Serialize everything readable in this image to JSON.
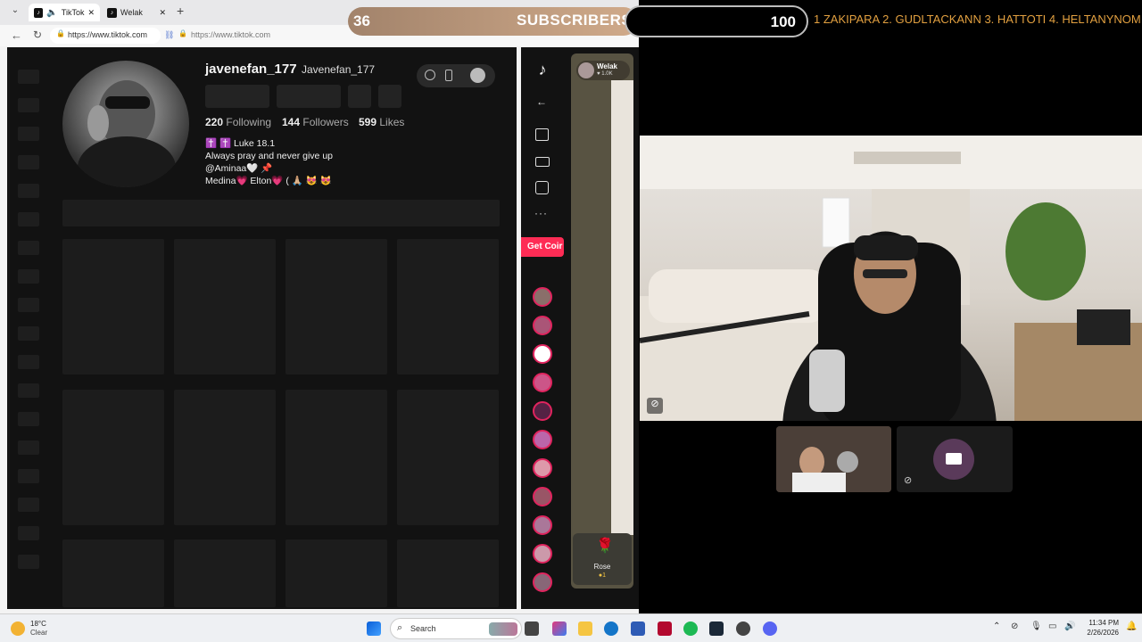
{
  "browser": {
    "tabs": [
      {
        "label": "TikTok"
      },
      {
        "label": "Welak"
      }
    ],
    "address": {
      "url": "https://www.tiktok.com",
      "url2": "https://www.tiktok.com"
    }
  },
  "profile": {
    "username": "javenefan_177",
    "display_name": "Javenefan_177",
    "following_count": "220",
    "following_label": "Following",
    "followers_count": "144",
    "followers_label": "Followers",
    "likes_count": "599",
    "likes_label": "Likes",
    "bio": [
      "✝️ ✝️ Luke 18.1",
      "Always pray and never give up",
      "@Aminaa🤍 📌",
      "Medina💗 Elton💗 ( 🙏🏼 😻 😻"
    ]
  },
  "live": {
    "get_coins": "Get Coir",
    "host": "Welak",
    "host_likes": "♥ 1.0K",
    "gift_name": "Rose",
    "gift_cost": "1"
  },
  "overlay": {
    "subs_count": "36",
    "subs_label": "SUBSCRIBERS",
    "goal": "100",
    "ticker": "1 ZAKIPARA 2. GUDLTACKANN  3. HATTOTI 4. HELTANYNOM"
  },
  "taskbar": {
    "weather_temp": "18°C",
    "weather_desc": "Clear",
    "search_label": "Search",
    "time": "11:34 PM",
    "date": "2/26/2026"
  },
  "colors": {
    "accent_pink": "#fe2c55",
    "ticker": "#e2a040"
  }
}
